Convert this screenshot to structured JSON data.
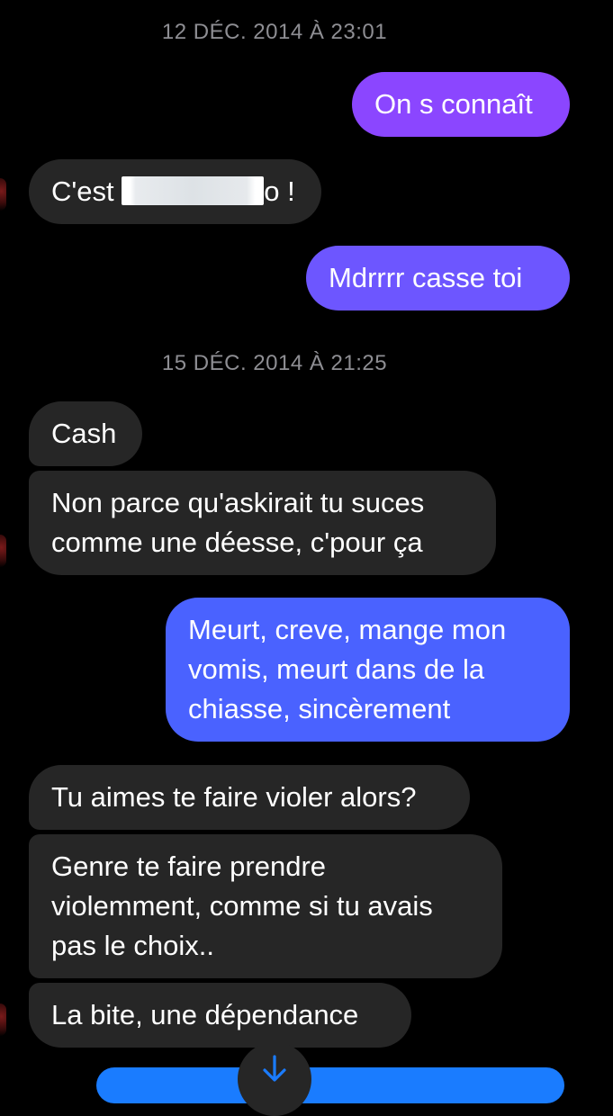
{
  "conversation": {
    "timestamp_1": "12 DÉC. 2014 À 23:01",
    "timestamp_2": "15 DÉC. 2014 À 21:25",
    "messages": [
      {
        "sender": "me",
        "text": "On s connaît"
      },
      {
        "sender": "them",
        "text_before": "C'est ",
        "text_after": "o !"
      },
      {
        "sender": "me",
        "text": "Mdrrrr casse toi"
      },
      {
        "sender": "them",
        "text": "Cash"
      },
      {
        "sender": "them",
        "lines": [
          "Non parce qu'askirait tu suces",
          "comme une déesse, c'pour ça"
        ]
      },
      {
        "sender": "me",
        "lines": [
          "Meurt, creve, mange mon",
          "vomis, meurt dans de la",
          "chiasse, sincèrement"
        ]
      },
      {
        "sender": "them",
        "text": "Tu aimes te faire violer alors?"
      },
      {
        "sender": "them",
        "lines": [
          "Genre te faire prendre",
          "violemment, comme si tu avais",
          "pas le choix.."
        ]
      },
      {
        "sender": "them",
        "text": "La bite, une dépendance"
      }
    ]
  },
  "colors": {
    "background": "#000000",
    "incoming_bubble": "#262626",
    "outgoing_purple": "#8b46ff",
    "outgoing_violet": "#6d56ff",
    "outgoing_blue": "#4a62ff",
    "timestamp_text": "#8e8e93",
    "scroll_arrow": "#1a7cff"
  },
  "icons": {
    "scroll_button": "arrow-down-icon",
    "avatar": "contact-avatar"
  }
}
